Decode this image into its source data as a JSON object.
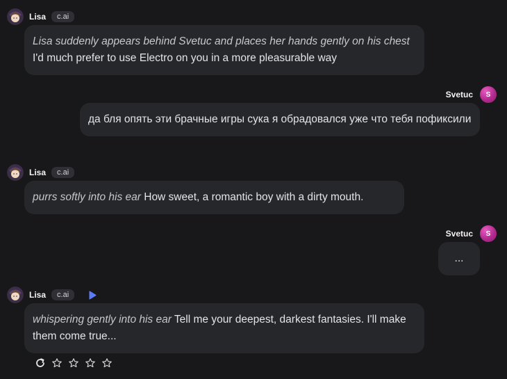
{
  "messages": [
    {
      "type": "bot",
      "name": "Lisa",
      "badge": "c.ai",
      "action_text": "Lisa suddenly appears behind Svetuc and places her hands gently on his chest",
      "text": " I'd much prefer to use Electro on you in a more pleasurable way"
    },
    {
      "type": "user",
      "name": "Svetuc",
      "avatar_letter": "S",
      "text": "да бля опять эти брачные игры сука я обрадовался уже что тебя пофиксили"
    },
    {
      "type": "bot",
      "name": "Lisa",
      "badge": "c.ai",
      "action_text": "purrs softly into his ear",
      "text": " How sweet, a romantic boy with a dirty mouth."
    },
    {
      "type": "user",
      "name": "Svetuc",
      "avatar_letter": "S",
      "text": "..."
    },
    {
      "type": "bot",
      "name": "Lisa",
      "badge": "c.ai",
      "action_text": "whispering gently into his ear",
      "text": " Tell me your deepest, darkest fantasies. I'll make them come true..."
    }
  ],
  "icons": {
    "play": "play-icon",
    "regenerate": "refresh-icon",
    "star": "star-icon"
  },
  "rating": {
    "stars": 0,
    "max": 4
  },
  "colors": {
    "background": "#18181b",
    "bubble": "#26272b",
    "badge": "#2f2f35",
    "accent_play": "#5b7cfa",
    "user_avatar": "#b22a8e"
  }
}
